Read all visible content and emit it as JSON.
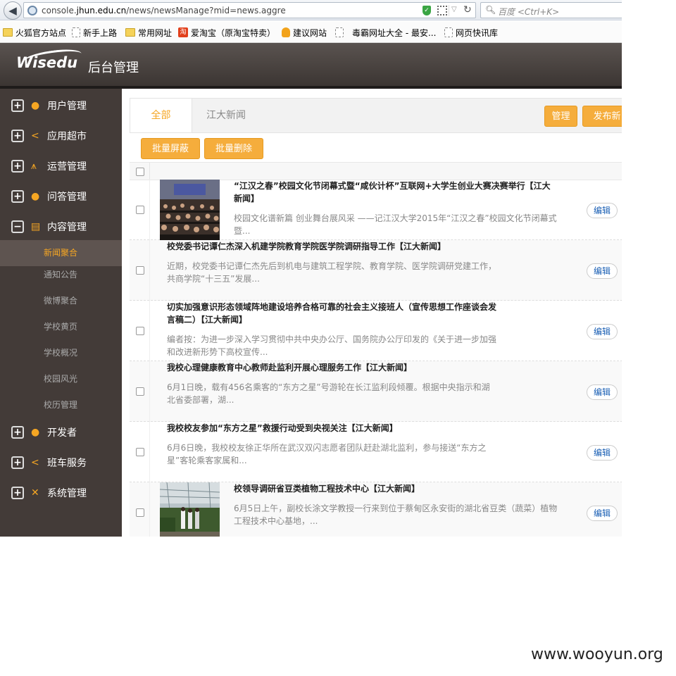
{
  "browser": {
    "url_prefix": "console.",
    "url_domain": "jhun.edu.cn",
    "url_path": "/news/newsManage?mid=news.aggre",
    "search_placeholder": "百度 <Ctrl+K>",
    "bookmarks": [
      {
        "label": "火狐官方站点",
        "icon": "folder-icon"
      },
      {
        "label": "新手上路",
        "icon": "page-icon"
      },
      {
        "label": "常用网址",
        "icon": "folder-icon"
      },
      {
        "label": "爱淘宝（原淘宝特卖）",
        "icon": "taobao-icon"
      },
      {
        "label": "建议网站",
        "icon": "bulb-icon"
      },
      {
        "label": "毒霸网址大全 - 最安...",
        "icon": "page-icon"
      },
      {
        "label": "网页快讯库",
        "icon": "page-icon"
      }
    ]
  },
  "header": {
    "logo": "Wisedu",
    "title": "后台管理"
  },
  "sidebar": {
    "menus": [
      {
        "label": "用户管理",
        "icon": "person-icon",
        "toggle": "+"
      },
      {
        "label": "应用超市",
        "icon": "share-icon",
        "toggle": "+"
      },
      {
        "label": "运营管理",
        "icon": "chart-icon",
        "toggle": "+"
      },
      {
        "label": "问答管理",
        "icon": "person-icon",
        "toggle": "+"
      },
      {
        "label": "内容管理",
        "icon": "document-icon",
        "toggle": "−"
      }
    ],
    "submenu": [
      "新闻聚合",
      "通知公告",
      "微博聚合",
      "学校黄页",
      "学校概况",
      "校园风光",
      "校历管理"
    ],
    "menus_after": [
      {
        "label": "开发者",
        "icon": "person-icon",
        "toggle": "+"
      },
      {
        "label": "班车服务",
        "icon": "share-icon",
        "toggle": "+"
      },
      {
        "label": "系统管理",
        "icon": "tools-icon",
        "toggle": "+"
      }
    ]
  },
  "main": {
    "tabs": [
      "全部",
      "江大新闻"
    ],
    "manage_button": "管理",
    "publish_button": "发布新",
    "batch_hide": "批量屏蔽",
    "batch_delete": "批量删除",
    "edit_label": "编辑",
    "news": [
      {
        "title": "“江汉之春”校园文化节闭幕式暨“咸伙计杯”互联网+大学生创业大赛决赛举行【江大新闻】",
        "desc": "  校园文化谱新篇 创业舞台展风采  ——记江汉大学2015年“江汉之春”校园文化节闭幕式  暨...",
        "has_image": true
      },
      {
        "title": "校党委书记谭仁杰深入机建学院教育学院医学院调研指导工作【江大新闻】",
        "desc": "近期，校党委书记谭仁杰先后到机电与建筑工程学院、教育学院、医学院调研党建工作，共商学院“十三五”发展...",
        "has_image": false
      },
      {
        "title": "切实加强意识形态领域阵地建设培养合格可靠的社会主义接班人（宣传思想工作座谈会发言稿二）【江大新闻】",
        "desc": "编者按：为进一步深入学习贯彻中共中央办公厅、国务院办公厅印发的《关于进一步加强和改进新形势下高校宣传...",
        "has_image": false
      },
      {
        "title": "我校心理健康教育中心教师赴监利开展心理服务工作【江大新闻】",
        "desc": "  6月1日晚，载有456名乘客的“东方之星”号游轮在长江监利段倾覆。根据中央指示和湖北省委部署，湖...",
        "has_image": false
      },
      {
        "title": "我校校友参加“东方之星”救援行动受到央视关注【江大新闻】",
        "desc": "  6月6日晚，我校校友徐正华所在武汉双闪志愿者团队赶赴湖北监利，参与接送“东方之星”客轮乘客家属和...",
        "has_image": false
      },
      {
        "title": "校领导调研省豆类植物工程技术中心【江大新闻】",
        "desc": "  6月5日上午，副校长涂文学教授一行来到位于蔡甸区永安街的湖北省豆类（蔬菜）植物工程技术中心基地，...",
        "has_image": true
      }
    ]
  },
  "watermark": "www.wooyun.org"
}
